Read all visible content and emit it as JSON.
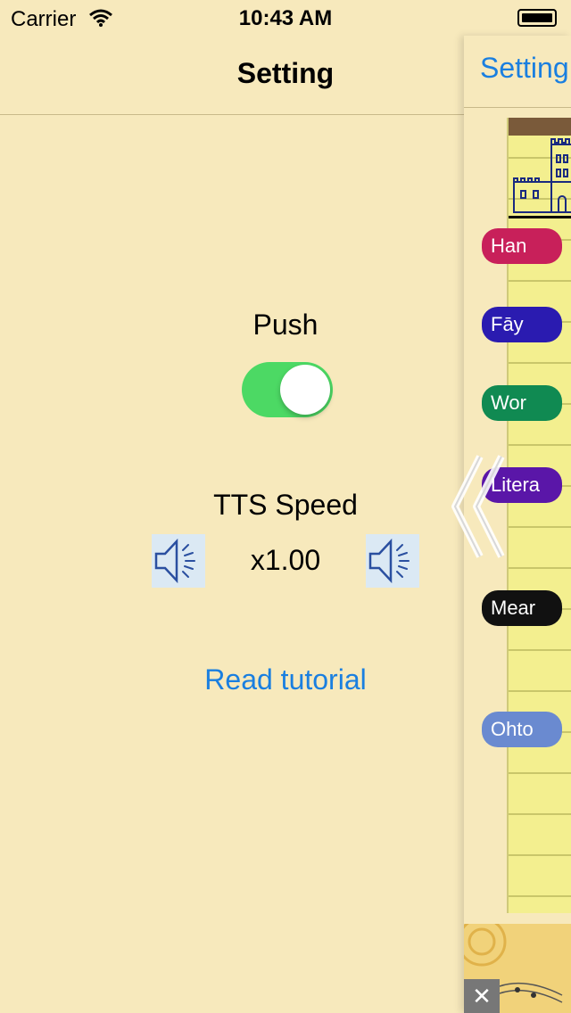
{
  "status_bar": {
    "carrier": "Carrier",
    "time": "10:43 AM"
  },
  "settings": {
    "title": "Setting",
    "push_label": "Push",
    "push_enabled": true,
    "tts_label": "TTS Speed",
    "tts_speed": "x1.00",
    "tutorial_link": "Read tutorial"
  },
  "right_panel": {
    "back_label": "Setting",
    "pills": [
      {
        "label": "Han",
        "color": "#c8205a"
      },
      {
        "label": "Fāy",
        "color": "#2a1bb0"
      },
      {
        "label": "Wor",
        "color": "#108a52"
      },
      {
        "label": "Litera",
        "color": "#5a16a8"
      },
      {
        "label": "Mear",
        "color": "#111111"
      },
      {
        "label": "Ohto",
        "color": "#6a8ad0"
      }
    ],
    "ad_close": "✕"
  },
  "colors": {
    "background": "#f7e9bc",
    "accent": "#1a7fe0",
    "toggle_on": "#4cd964"
  },
  "icons": [
    "wifi-icon",
    "battery-icon",
    "speaker-icon",
    "swipe-chevron-icon",
    "castle-icon",
    "close-icon"
  ]
}
